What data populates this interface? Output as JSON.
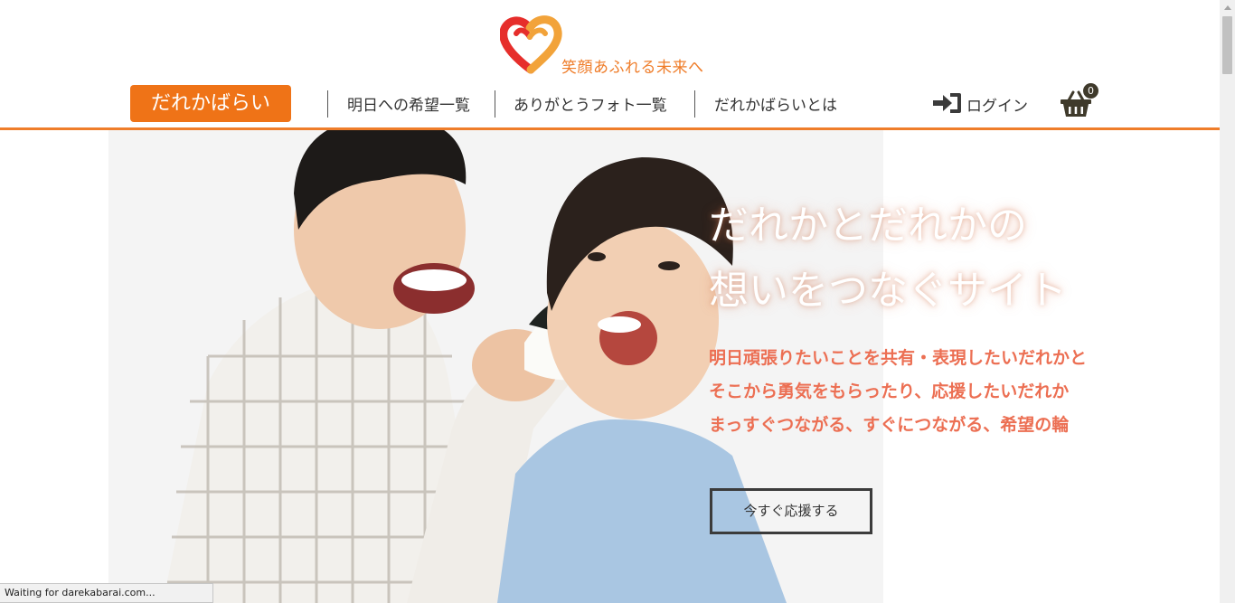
{
  "header": {
    "logo_text": "笑顔あふれる未来へ"
  },
  "nav": {
    "brand_label": "だれかばらい",
    "links": [
      {
        "label": "明日への希望一覧"
      },
      {
        "label": "ありがとうフォト一覧"
      },
      {
        "label": "だれかばらいとは"
      }
    ],
    "login_label": "ログイン",
    "cart_count": "0"
  },
  "hero": {
    "headline_line1": "だれかとだれかの",
    "headline_line2": "想いをつなぐサイト",
    "sub_line1": "明日頑張りたいことを共有・表現したいだれかと",
    "sub_line2": "そこから勇気をもらったり、応援したいだれか",
    "sub_line3": "まっすぐつながる、すぐにつながる、希望の輪",
    "cta_label": "今すぐ応援する"
  },
  "status": {
    "text": "Waiting for darekabarai.com..."
  },
  "colors": {
    "accent": "#ef7317",
    "logo_red": "#e62e2b",
    "logo_orange": "#f2a33a",
    "subtext": "#ec6f53"
  },
  "icons": [
    "heart-logo-icon",
    "login-icon",
    "cart-basket-icon",
    "scroll-up-arrow-icon"
  ]
}
